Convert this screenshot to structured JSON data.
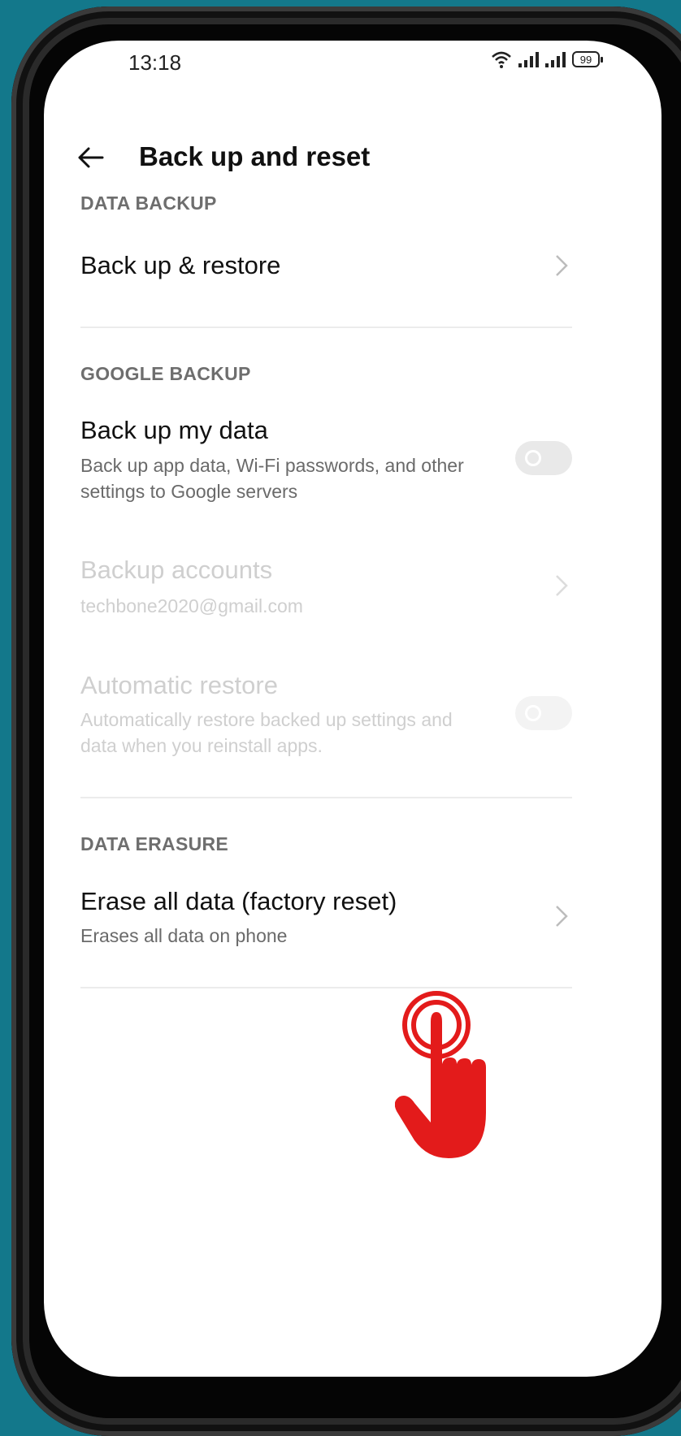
{
  "status_bar": {
    "time": "13:18",
    "battery": "99"
  },
  "header": {
    "title": "Back up and reset"
  },
  "sections": {
    "data_backup": {
      "label": "DATA BACKUP",
      "backup_restore": {
        "title": "Back up & restore"
      }
    },
    "google_backup": {
      "label": "GOOGLE BACKUP",
      "backup_my_data": {
        "title": "Back up my data",
        "subtitle": "Back up app data, Wi-Fi passwords, and other settings to Google servers",
        "enabled": false
      },
      "backup_accounts": {
        "title": "Backup accounts",
        "subtitle": "techbone2020@gmail.com"
      },
      "automatic_restore": {
        "title": "Automatic restore",
        "subtitle": "Automatically restore backed up settings and data when you reinstall apps.",
        "enabled": false
      }
    },
    "data_erasure": {
      "label": "DATA ERASURE",
      "erase_all": {
        "title": "Erase all data (factory reset)",
        "subtitle": "Erases all data on phone"
      }
    }
  },
  "colors": {
    "background": "#13788b",
    "pointer_hand": "#e31b1b"
  },
  "icons": [
    "back-arrow-icon",
    "wifi-icon",
    "signal-icon",
    "battery-icon",
    "chevron-right-icon",
    "tap-hand-icon"
  ]
}
